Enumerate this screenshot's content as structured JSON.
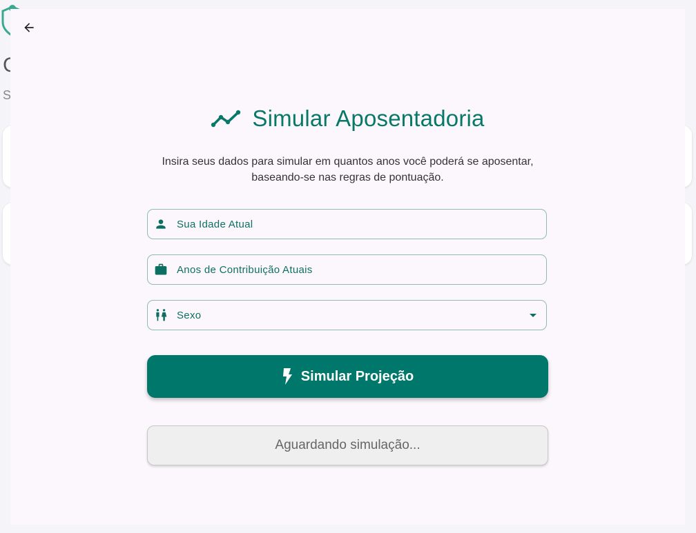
{
  "background": {
    "title_fragment": "C",
    "subtitle_fragment": "S"
  },
  "modal": {
    "title": "Simular Aposentadoria",
    "description_line1": "Insira seus dados para simular em quantos anos você poderá se aposentar,",
    "description_line2": "baseando-se nas regras de pontuação.",
    "fields": {
      "age_label": "Sua Idade Atual",
      "contribution_label": "Anos de Contribuição Atuais",
      "sex_label": "Sexo"
    },
    "simulate_button_label": "Simular Projeção",
    "status_text": "Aguardando simulação..."
  },
  "icons": {
    "back": "arrow-left-icon",
    "title": "trending-line-icon",
    "age": "person-icon",
    "contribution": "briefcase-icon",
    "sex": "wc-icon",
    "simulate": "bolt-icon"
  },
  "colors": {
    "accent": "#00776b",
    "accent_text": "#087868",
    "modal_background": "#fcf7fc"
  }
}
